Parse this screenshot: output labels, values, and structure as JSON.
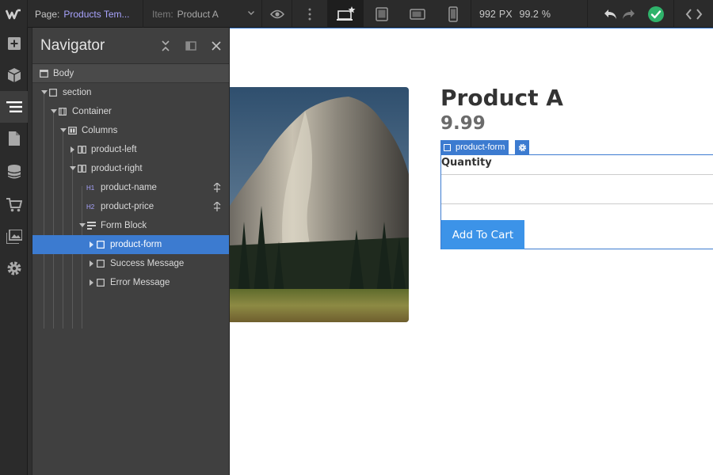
{
  "topbar": {
    "page_label": "Page:",
    "page_value": "Products Tem...",
    "item_label": "Item:",
    "item_value": "Product A",
    "width_value": "992",
    "width_unit": "PX",
    "zoom_value": "99.2",
    "zoom_unit": "%"
  },
  "colors": {
    "accent": "#3c7bd0",
    "button": "#3c93e8",
    "success": "#2fb36b",
    "page_link": "#a9a4ff"
  },
  "navigator": {
    "title": "Navigator",
    "tree": [
      {
        "label": "Body",
        "icon": "body-icon"
      },
      {
        "label": "section",
        "icon": "box-icon"
      },
      {
        "label": "Container",
        "icon": "container-icon"
      },
      {
        "label": "Columns",
        "icon": "columns-icon"
      },
      {
        "label": "product-left",
        "icon": "column-icon"
      },
      {
        "label": "product-right",
        "icon": "column-icon"
      },
      {
        "label": "product-name",
        "icon": "h1-icon",
        "tag": "H1"
      },
      {
        "label": "product-price",
        "icon": "h2-icon",
        "tag": "H2"
      },
      {
        "label": "Form Block",
        "icon": "form-block-icon"
      },
      {
        "label": "product-form",
        "icon": "box-icon",
        "selected": true
      },
      {
        "label": "Success Message",
        "icon": "box-icon"
      },
      {
        "label": "Error Message",
        "icon": "box-icon"
      }
    ]
  },
  "canvas": {
    "product_name": "Product A",
    "product_price": "9.99",
    "selection_label": "product-form",
    "quantity_label": "Quantity",
    "add_button": "Add To Cart"
  }
}
